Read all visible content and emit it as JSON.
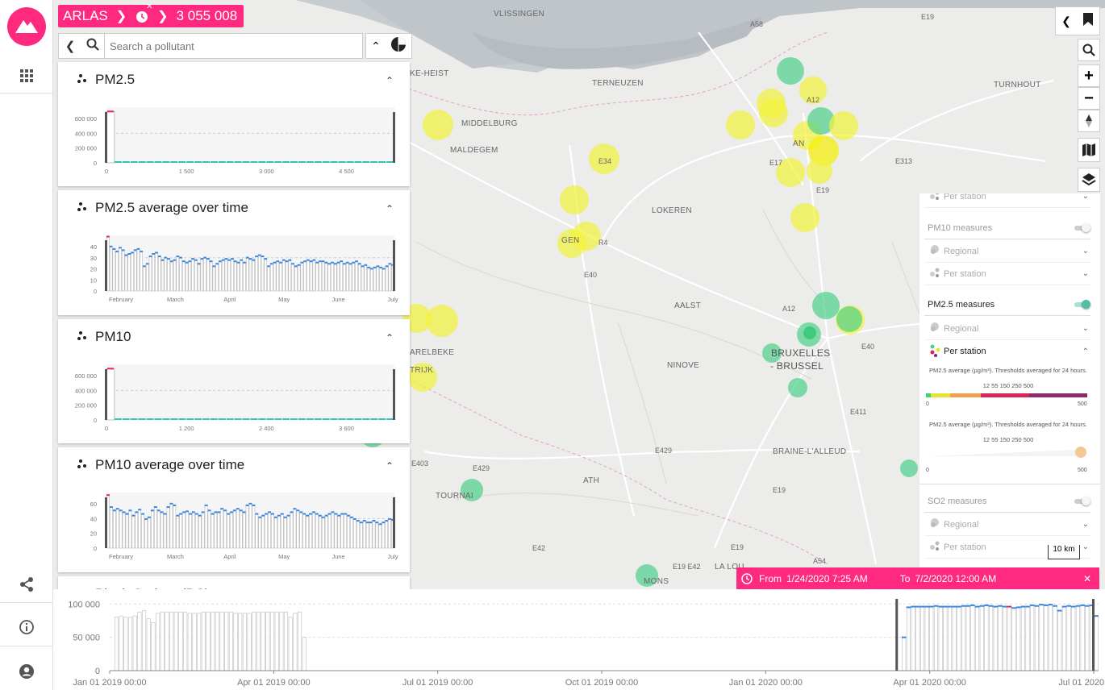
{
  "app": {
    "name": "ARLAS",
    "count": "3 055 008",
    "brand_color": "#ff2a7f"
  },
  "search": {
    "placeholder": "Search a pollutant"
  },
  "map": {
    "cities": [
      "VLISSINGEN",
      "TERNEUZEN",
      "MIDDELBURG",
      "MALDEGEM",
      "LOKEREN",
      "AALST",
      "NINOVE",
      "BRUXELLES",
      "- BRUSSEL",
      "BRAINE-L'ALLEUD",
      "ATH",
      "TOURNAI",
      "MONS",
      "LA LOU",
      "TURNHOUT",
      "KE-HEIST",
      "AN",
      "ARELBEKE",
      "TRIJK",
      "GEN"
    ],
    "roads": [
      "A58",
      "E19",
      "A12",
      "E34",
      "E17",
      "E313",
      "E19",
      "R4",
      "E40",
      "A12",
      "E40",
      "E411",
      "E429",
      "E429",
      "E19",
      "E42",
      "E19 E42",
      "A54",
      "E19",
      "E403",
      "E42",
      "E19"
    ],
    "scale_label": "10 km"
  },
  "widgets": [
    {
      "title": "PM2.5",
      "kind": "histogram",
      "y_ticks": [
        "600 000",
        "400 000",
        "200 000",
        "0"
      ],
      "x_ticks": [
        "0",
        "1 500",
        "3 000",
        "4 500"
      ],
      "chart_data": {
        "type": "bar",
        "x": [
          0,
          150,
          300,
          450,
          600,
          750,
          900,
          1050,
          1200,
          1350,
          1500,
          1650,
          1800,
          1950,
          2100,
          2250,
          2400,
          2550,
          2700,
          2850,
          3000,
          3150,
          3300,
          3450,
          3600,
          3750,
          3900,
          4050,
          4200,
          4350,
          4500,
          4650,
          4800,
          4950,
          5100,
          5250
        ],
        "values": [
          600000,
          2000,
          1000,
          500,
          500,
          500,
          500,
          500,
          500,
          500,
          500,
          500,
          500,
          500,
          500,
          500,
          500,
          500,
          500,
          500,
          500,
          500,
          500,
          500,
          500,
          500,
          500,
          500,
          500,
          500,
          500,
          500,
          500,
          500,
          500,
          500
        ],
        "ylim": [
          0,
          650000
        ]
      }
    },
    {
      "title": "PM2.5 average over time",
      "kind": "timeseries",
      "y_ticks": [
        "40",
        "30",
        "20",
        "10",
        "0"
      ],
      "x_ticks": [
        "February",
        "March",
        "April",
        "May",
        "June",
        "July"
      ],
      "chart_data": {
        "type": "bar",
        "values": [
          44,
          36,
          34,
          32,
          35,
          33,
          29,
          30,
          31,
          33,
          34,
          32,
          20,
          22,
          28,
          30,
          31,
          28,
          25,
          27,
          26,
          24,
          25,
          28,
          27,
          24,
          23,
          24,
          26,
          25,
          22,
          26,
          27,
          26,
          24,
          20,
          22,
          24,
          25,
          26,
          25,
          26,
          24,
          23,
          25,
          23,
          27,
          26,
          25,
          28,
          29,
          28,
          26,
          20,
          22,
          23,
          24,
          23,
          25,
          24,
          25,
          22,
          20,
          21,
          23,
          24,
          25,
          24,
          25,
          23,
          24,
          24,
          23,
          22,
          23,
          22,
          23,
          24,
          22,
          23,
          22,
          23,
          24,
          22,
          20,
          21,
          19,
          18,
          19,
          20,
          19,
          18,
          20,
          22,
          21
        ],
        "ylim": [
          0,
          45
        ]
      }
    },
    {
      "title": "PM10",
      "kind": "histogram",
      "y_ticks": [
        "600 000",
        "400 000",
        "200 000",
        "0"
      ],
      "x_ticks": [
        "0",
        "1 200",
        "2 400",
        "3 600"
      ],
      "chart_data": {
        "type": "bar",
        "x": [
          0,
          120,
          240,
          360,
          480,
          600,
          720,
          840,
          960,
          1080,
          1200,
          1320,
          1440,
          1560,
          1680,
          1800,
          1920,
          2040,
          2160,
          2280,
          2400,
          2520,
          2640,
          2760,
          2880,
          3000,
          3120,
          3240,
          3360,
          3480,
          3600,
          3720,
          3840,
          3960,
          4080,
          4200
        ],
        "values": [
          600000,
          3000,
          1500,
          1000,
          500,
          500,
          500,
          500,
          500,
          500,
          500,
          500,
          500,
          500,
          500,
          500,
          500,
          500,
          500,
          500,
          500,
          500,
          500,
          500,
          500,
          500,
          500,
          500,
          500,
          500,
          500,
          500,
          500,
          500,
          500,
          500
        ],
        "ylim": [
          0,
          650000
        ]
      }
    },
    {
      "title": "PM10 average over time",
      "kind": "timeseries",
      "y_ticks": [
        "60",
        "40",
        "20",
        "0"
      ],
      "x_ticks": [
        "February",
        "March",
        "April",
        "May",
        "June",
        "July"
      ],
      "chart_data": {
        "type": "bar",
        "values": [
          62,
          48,
          44,
          46,
          44,
          42,
          40,
          44,
          38,
          42,
          45,
          40,
          34,
          36,
          44,
          48,
          44,
          42,
          40,
          48,
          52,
          50,
          38,
          40,
          42,
          43,
          40,
          42,
          40,
          38,
          42,
          50,
          44,
          40,
          42,
          42,
          46,
          44,
          40,
          42,
          44,
          46,
          44,
          42,
          50,
          52,
          50,
          40,
          36,
          38,
          40,
          42,
          40,
          36,
          38,
          40,
          36,
          38,
          42,
          46,
          44,
          42,
          40,
          38,
          40,
          42,
          40,
          38,
          36,
          38,
          40,
          42,
          40,
          38,
          40,
          40,
          38,
          36,
          34,
          32,
          30,
          32,
          30,
          30,
          32,
          30,
          28,
          30,
          32,
          34,
          33
        ],
        "ylim": [
          0,
          65
        ]
      }
    }
  ],
  "next_widget_title": "Black Carbon (BC)",
  "layers_panel": {
    "rows": [
      {
        "label": "Per station",
        "type": "sub"
      },
      {
        "label": "PM10 measures",
        "type": "head",
        "on": false
      },
      {
        "label": "Regional",
        "type": "sub"
      },
      {
        "label": "Per station",
        "type": "sub"
      },
      {
        "label": "PM2.5 measures",
        "type": "head",
        "on": true
      },
      {
        "label": "Regional",
        "type": "sub"
      },
      {
        "label": "Per station",
        "type": "sub-active"
      }
    ],
    "legend1": {
      "text": "PM2.5 average (µg/m³). Thresholds averaged for 24 hours. 12 55 150 250 500",
      "min": "0",
      "max": "500"
    },
    "legend2": {
      "text": "PM2.5 average (µg/m³). Thresholds averaged for 24 hours. 12 55 150 250 500",
      "min": "0",
      "max": "500"
    },
    "rows2": [
      {
        "label": "SO2 measures",
        "type": "head",
        "on": false
      },
      {
        "label": "Regional",
        "type": "sub"
      },
      {
        "label": "Per station",
        "type": "sub"
      }
    ]
  },
  "time_range": {
    "from_label": "From",
    "from": "1/24/2020 7:25 AM",
    "to_label": "To",
    "to": "7/2/2020 12:00 AM"
  },
  "timeline": {
    "y_ticks": [
      "100 000",
      "50 000",
      "0"
    ],
    "x_ticks": [
      "Jan 01 2019 00:00",
      "Apr 01 2019 00:00",
      "Jul 01 2019 00:00",
      "Oct 01 2019 00:00",
      "Jan 01 2020 00:00",
      "Apr 01 2020 00:00",
      "Jul 01 2020 00:00"
    ],
    "chart_data": {
      "type": "bar",
      "values": [
        0,
        80000,
        82000,
        80000,
        80000,
        82000,
        88000,
        90000,
        78000,
        72000,
        86000,
        88000,
        88000,
        88000,
        88000,
        88000,
        88000,
        86000,
        86000,
        86000,
        88000,
        88000,
        88000,
        88000,
        88000,
        88000,
        88000,
        86000,
        86000,
        86000,
        86000,
        88000,
        88000,
        88000,
        88000,
        88000,
        88000,
        88000,
        88000,
        80000,
        86000,
        88000,
        50000,
        0,
        0,
        0,
        0,
        0,
        0,
        0,
        0,
        0,
        0,
        0,
        0,
        0,
        0,
        0,
        0,
        0,
        0,
        0,
        0,
        0,
        0,
        0,
        0,
        0,
        0,
        0,
        0,
        0,
        0,
        0,
        0,
        0,
        0,
        0,
        0,
        0,
        0,
        0,
        0,
        0,
        0,
        0,
        0,
        0,
        0,
        0,
        0,
        0,
        0,
        0,
        0,
        0,
        0,
        0,
        0,
        0,
        0,
        0,
        0,
        0,
        0,
        0,
        0,
        0,
        0,
        0,
        0,
        0,
        0,
        0,
        0,
        0,
        0,
        0,
        0,
        0,
        0,
        0,
        0,
        0,
        0,
        0,
        0,
        0,
        0,
        0,
        0,
        0,
        0,
        0,
        0,
        0,
        0,
        0,
        0,
        0,
        0,
        0,
        0,
        0,
        0,
        0,
        0,
        0,
        0,
        0,
        0,
        0,
        0,
        0,
        0,
        0,
        0,
        0,
        0,
        0,
        0,
        0,
        0,
        0,
        0,
        0,
        0,
        0,
        0,
        0,
        0,
        0,
        0,
        50000,
        95000,
        96000,
        96000,
        96000,
        96000,
        96000,
        97000,
        96000,
        96000,
        96000,
        96000,
        96000,
        97000,
        97000,
        98000,
        96000,
        97000,
        98000,
        97000,
        96000,
        97000,
        96000,
        96000,
        94000,
        95000,
        96000,
        96000,
        98000,
        97000,
        99000,
        98000,
        99000,
        97000,
        90000,
        96000,
        97000,
        96000,
        97000,
        98000,
        97000,
        98000,
        82000
      ],
      "ylim": [
        0,
        110000
      ]
    }
  }
}
